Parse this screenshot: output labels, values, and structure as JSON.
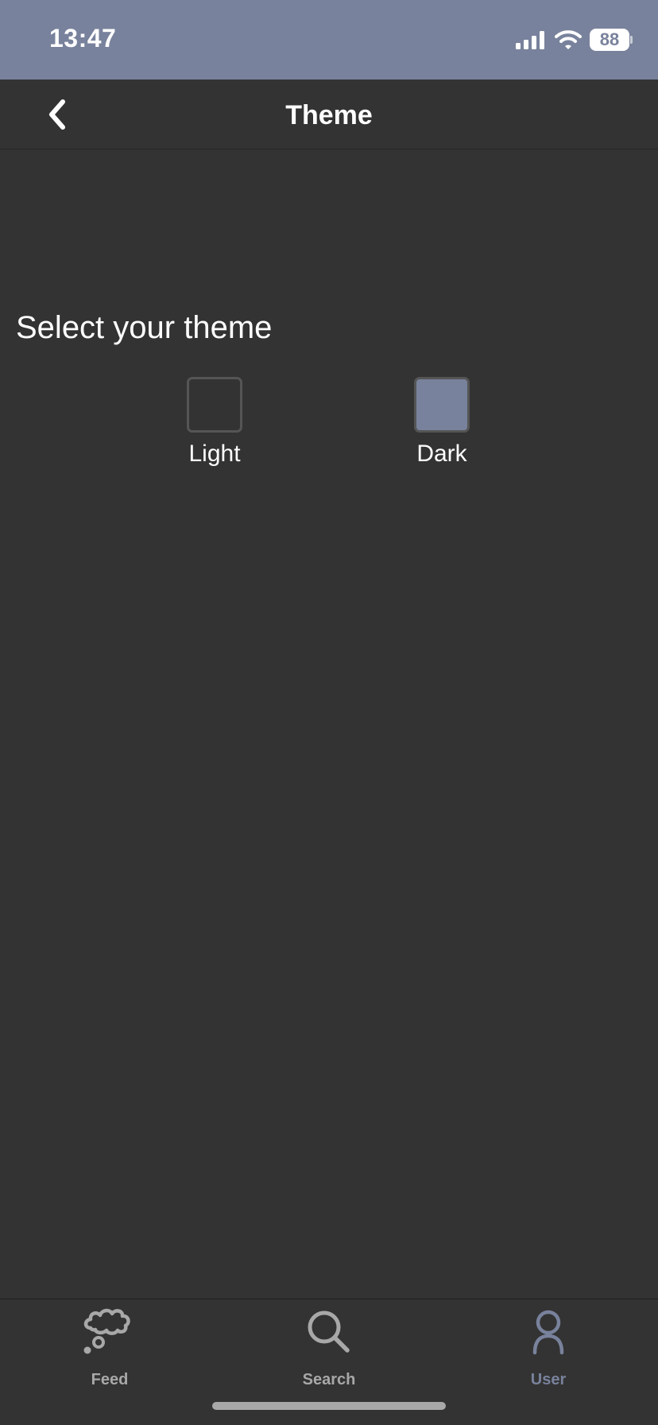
{
  "status_bar": {
    "time": "13:47",
    "battery": "88",
    "background_color": "#79829C"
  },
  "nav": {
    "title": "Theme",
    "back_icon": "chevron-left-icon"
  },
  "theme_picker": {
    "heading": "Select your theme",
    "selected": "Dark",
    "options": [
      {
        "label": "Light",
        "selected": false,
        "swatch_color": "transparent"
      },
      {
        "label": "Dark",
        "selected": true,
        "swatch_color": "#79829C"
      }
    ]
  },
  "tab_bar": {
    "items": [
      {
        "label": "Feed",
        "icon": "thought-cloud-icon",
        "active": false,
        "color": "#A8A8A8"
      },
      {
        "label": "Search",
        "icon": "search-icon",
        "active": false,
        "color": "#A8A8A8"
      },
      {
        "label": "User",
        "icon": "user-icon",
        "active": true,
        "color": "#79829C"
      }
    ]
  },
  "colors": {
    "background": "#333333",
    "accent": "#79829C",
    "inactive": "#A8A8A8"
  }
}
